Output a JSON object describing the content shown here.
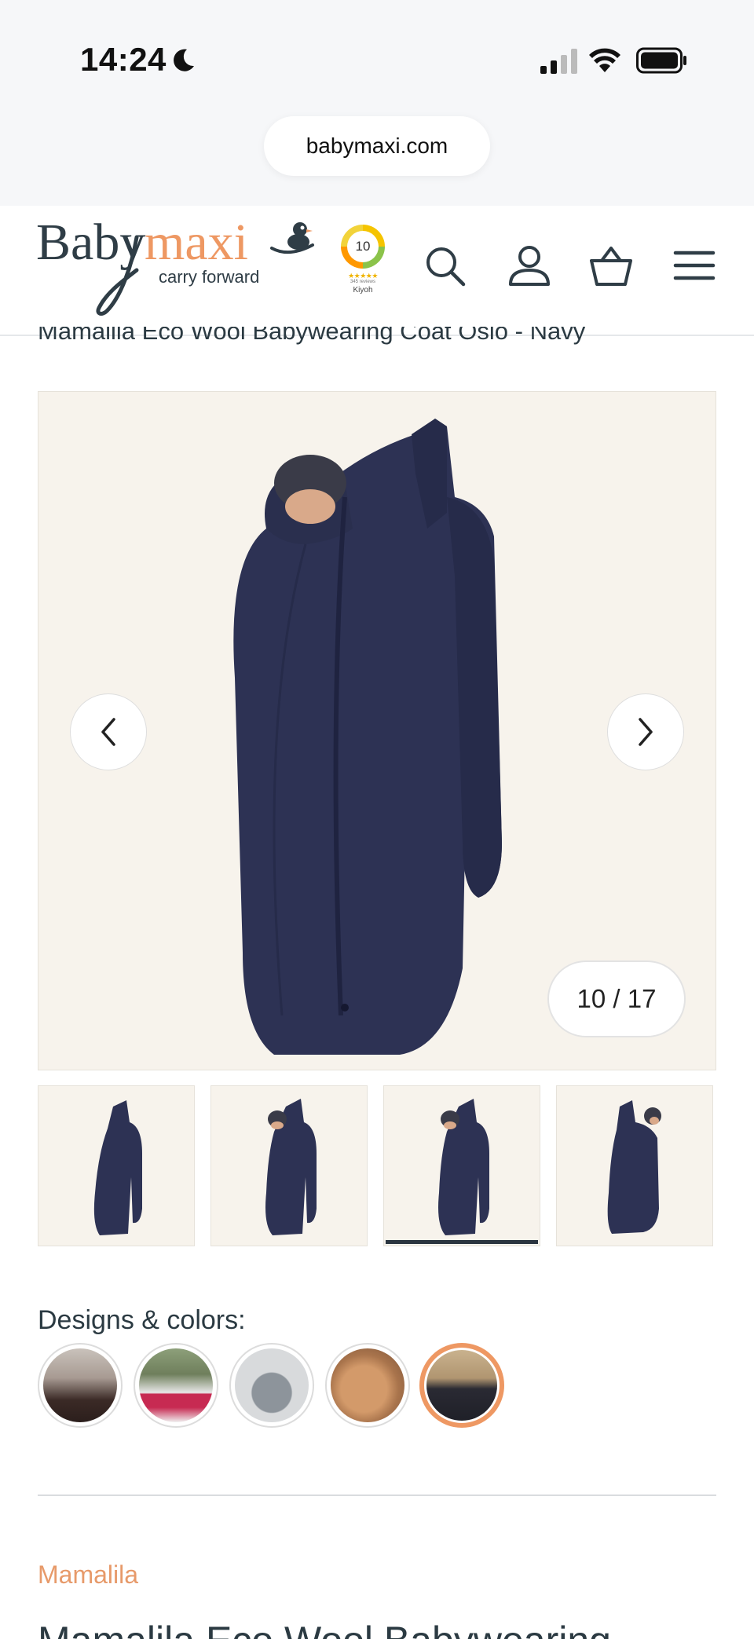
{
  "status_bar": {
    "time": "14:24",
    "icons": [
      "moon-icon",
      "signal-icon",
      "wifi-icon",
      "battery-icon"
    ]
  },
  "browser": {
    "url": "babymaxi.com"
  },
  "header": {
    "logo": {
      "primary": "Baby",
      "accent": "maxi",
      "tagline": "carry forward"
    },
    "rating_badge": {
      "score": "10",
      "reviews": "345 reviews",
      "source": "Kiyoh"
    },
    "icons": [
      "search-icon",
      "account-icon",
      "basket-icon",
      "menu-icon"
    ]
  },
  "product": {
    "title_strip": "Mamalila Eco Wool Babywearing Coat Oslo - Navy",
    "gallery": {
      "counter": "10 / 17",
      "current_index": 10,
      "total": 17,
      "thumbnail_count": 4,
      "active_thumbnail": 3
    },
    "designs_label": "Designs & colors:",
    "design_swatches": [
      {
        "name": "swatch-1",
        "active": false
      },
      {
        "name": "swatch-2",
        "active": false
      },
      {
        "name": "swatch-3",
        "active": false
      },
      {
        "name": "swatch-4",
        "active": false
      },
      {
        "name": "swatch-5",
        "active": true
      }
    ],
    "brand": "Mamalila",
    "title": "Mamalila Eco Wool Babywearing"
  },
  "colors": {
    "accent": "#ee9863",
    "brand_text": "#e79a6a",
    "text": "#2b3a42",
    "gallery_bg": "#f7f3ec",
    "coat": "#2d3254"
  }
}
